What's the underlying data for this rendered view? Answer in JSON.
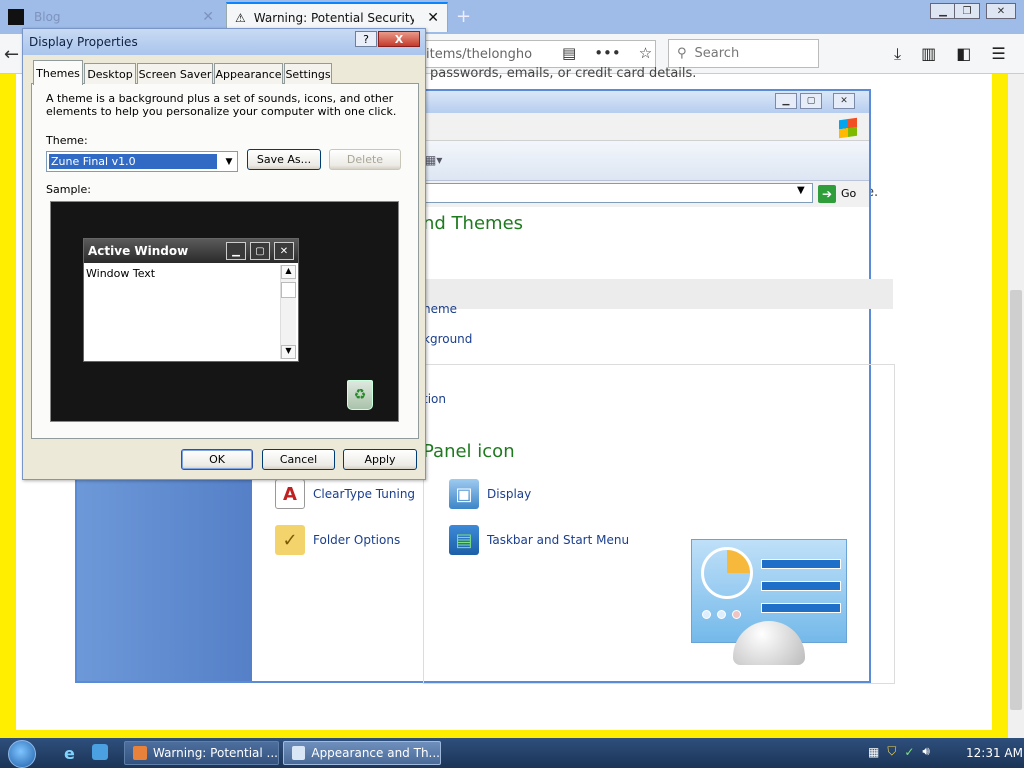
{
  "browser": {
    "tabs": [
      {
        "label": "Blog"
      },
      {
        "label": "Warning: Potential Security Risk"
      }
    ],
    "url": "items/thelongho",
    "search_placeholder": "Search",
    "page_text_top": "passwords, emails, or credit card details.",
    "page_text_go": "e."
  },
  "control_panel": {
    "go_label": "Go",
    "heading_partial": "nd Themes",
    "tasks": [
      "heme",
      "kground",
      "tion"
    ],
    "heading2_partial": "Panel icon",
    "items": [
      {
        "label": "ClearType Tuning",
        "icon": "cleartype-icon"
      },
      {
        "label": "Display",
        "icon": "display-icon"
      },
      {
        "label": "Folder Options",
        "icon": "folder-options-icon"
      },
      {
        "label": "Taskbar and Start Menu",
        "icon": "taskbar-start-menu-icon"
      }
    ]
  },
  "dialog": {
    "title": "Display Properties",
    "help_label": "?",
    "close_label": "X",
    "tabs": [
      "Themes",
      "Desktop",
      "Screen Saver",
      "Appearance",
      "Settings"
    ],
    "active_tab": "Themes",
    "description": "A theme is a background plus a set of sounds, icons, and other elements to help you personalize your computer with one click.",
    "theme_label": "Theme:",
    "theme_value": "Zune Final v1.0",
    "save_as_label": "Save As...",
    "delete_label": "Delete",
    "sample_label": "Sample:",
    "sample": {
      "title": "Active Window",
      "text": "Window Text"
    },
    "ok_label": "OK",
    "cancel_label": "Cancel",
    "apply_label": "Apply"
  },
  "taskbar": {
    "buttons": [
      {
        "label": "Warning: Potential ..."
      },
      {
        "label": "Appearance and Th..."
      }
    ],
    "clock": "12:31 AM"
  }
}
